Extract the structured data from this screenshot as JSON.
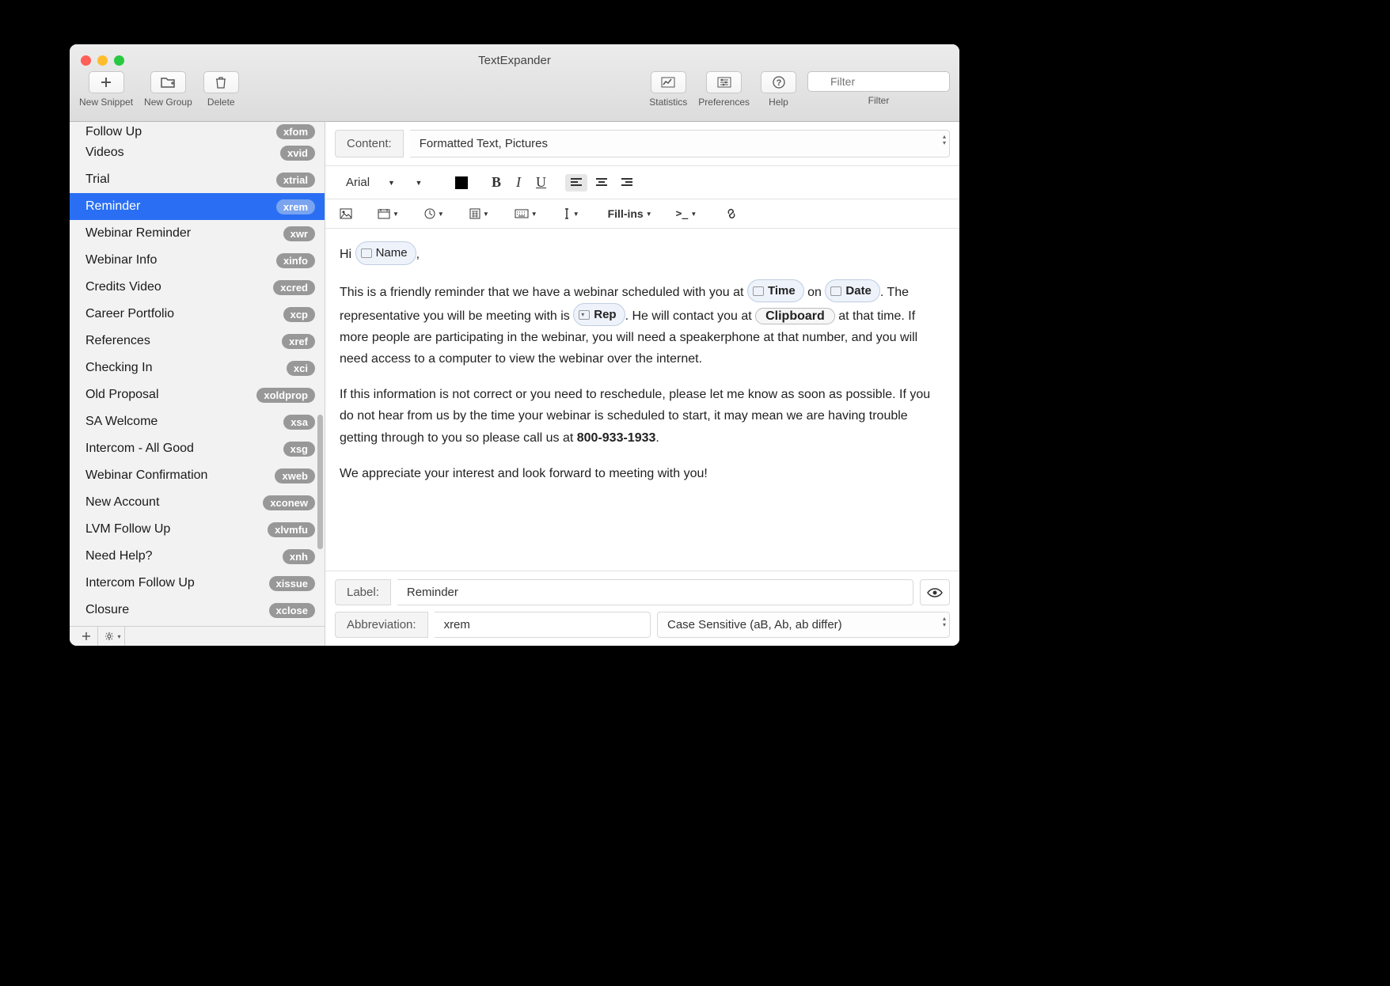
{
  "window_title": "TextExpander",
  "toolbar": {
    "new_snippet": "New Snippet",
    "new_group": "New Group",
    "delete": "Delete",
    "statistics": "Statistics",
    "preferences": "Preferences",
    "help": "Help",
    "filter_label": "Filter",
    "filter_placeholder": "Filter"
  },
  "sidebar": {
    "items": [
      {
        "label": "Follow Up",
        "abbr": "xfom",
        "cut": true
      },
      {
        "label": "Videos",
        "abbr": "xvid"
      },
      {
        "label": "Trial",
        "abbr": "xtrial"
      },
      {
        "label": "Reminder",
        "abbr": "xrem",
        "selected": true
      },
      {
        "label": "Webinar Reminder",
        "abbr": "xwr"
      },
      {
        "label": "Webinar Info",
        "abbr": "xinfo"
      },
      {
        "label": "Credits Video",
        "abbr": "xcred"
      },
      {
        "label": "Career Portfolio",
        "abbr": "xcp"
      },
      {
        "label": "References",
        "abbr": "xref"
      },
      {
        "label": "Checking In",
        "abbr": "xci"
      },
      {
        "label": "Old Proposal",
        "abbr": "xoldprop"
      },
      {
        "label": "SA Welcome",
        "abbr": "xsa"
      },
      {
        "label": "Intercom - All Good",
        "abbr": "xsg"
      },
      {
        "label": "Webinar Confirmation",
        "abbr": "xweb"
      },
      {
        "label": "New Account",
        "abbr": "xconew"
      },
      {
        "label": "LVM Follow Up",
        "abbr": "xlvmfu"
      },
      {
        "label": "Need Help?",
        "abbr": "xnh"
      },
      {
        "label": "Intercom Follow Up",
        "abbr": "xissue"
      },
      {
        "label": "Closure",
        "abbr": "xclose"
      }
    ]
  },
  "content": {
    "type_label": "Content:",
    "type_value": "Formatted Text, Pictures",
    "font": "Arial",
    "fillins_label": "Fill-ins",
    "body": {
      "hi": "Hi ",
      "name_pill": "Name",
      "comma": ",",
      "p1a": "This is a friendly reminder that we have a webinar scheduled with you at ",
      "time_pill": "Time",
      "p1b": " on ",
      "date_pill": "Date",
      "p1c": ". The representative you will be meeting with is ",
      "rep_pill": "Rep",
      "p1d": ". He will contact you at ",
      "clipboard": "Clipboard",
      "p1e": " at that time. If more people are participating in the webinar, you will need a speakerphone at that number, and you will need access to a computer to view the webinar over the internet.",
      "p2a": "If this information is not correct or you need to reschedule, please let me know as soon as possible. If you do not hear from us by the time your webinar is scheduled to start, it may mean we are having trouble getting through to you so please call us at ",
      "phone": "800-933-1933",
      "p2b": ".",
      "p3": "We appreciate your interest and look forward to meeting with you!"
    }
  },
  "label_section": {
    "label_name": "Label:",
    "label_value": "Reminder",
    "abbr_name": "Abbreviation:",
    "abbr_value": "xrem",
    "case_value": "Case Sensitive (aB, Ab, ab differ)"
  }
}
